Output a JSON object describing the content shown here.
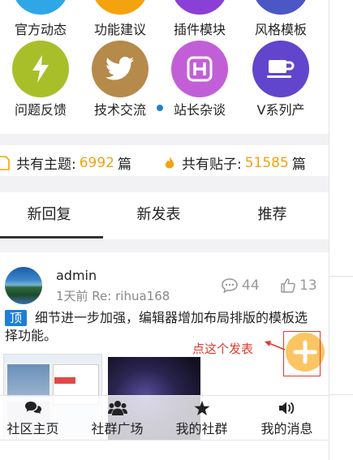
{
  "grid": {
    "row1": [
      {
        "label": "官方动态",
        "color": "#2fa7e6"
      },
      {
        "label": "功能建议",
        "color": "#f5a20f"
      },
      {
        "label": "插件模块",
        "color": "#8a3fd6"
      },
      {
        "label": "风格模板",
        "color": "#4a57c4"
      }
    ],
    "row2": [
      {
        "label": "问题反馈",
        "color": "#a9bf2a",
        "icon": "lightning-icon"
      },
      {
        "label": "技术交流",
        "color": "#b58a4a",
        "icon": "twitter-bird-icon"
      },
      {
        "label": "站长杂谈",
        "color": "#c25fd8",
        "icon": "h-square-icon"
      },
      {
        "label": "V系列产",
        "color": "#6145cc",
        "icon": "coffee-cup-icon"
      }
    ]
  },
  "stats": {
    "topics_label": "共有主题:",
    "topics_value": "6992",
    "topics_unit": "篇",
    "posts_label": "共有贴子:",
    "posts_value": "51585",
    "posts_unit": "篇"
  },
  "tabs": [
    "新回复",
    "新发表",
    "推荐"
  ],
  "post": {
    "author": "admin",
    "meta": "1天前 Re: rihua168",
    "comments": "44",
    "likes": "13",
    "badge": "顶",
    "content": "细节进一步加强，编辑器增加布局排版的模板选择功能。"
  },
  "annotation": "点这个发表",
  "bottom_nav": [
    {
      "label": "社区主页",
      "icon": "chat-bubbles-icon"
    },
    {
      "label": "社群广场",
      "icon": "group-icon"
    },
    {
      "label": "我的社群",
      "icon": "star-icon"
    },
    {
      "label": "我的消息",
      "icon": "speaker-icon"
    }
  ],
  "colors": {
    "accent_number": "#f2a30f",
    "badge_blue": "#1e7fd8",
    "fab_yellow": "#fbc564",
    "annotation_red": "#e03b2f"
  }
}
